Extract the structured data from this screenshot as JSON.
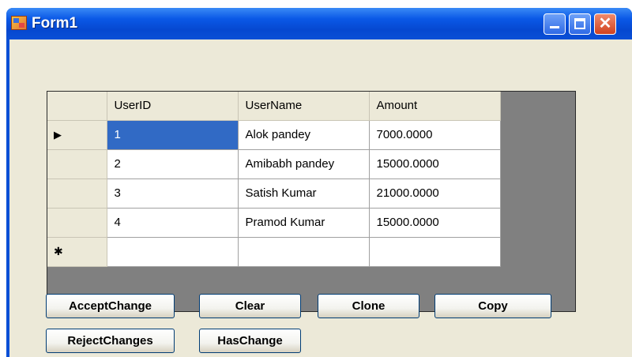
{
  "window": {
    "title": "Form1",
    "close_glyph": "✕"
  },
  "grid": {
    "columns": [
      "",
      "UserID",
      "UserName",
      "Amount"
    ],
    "current_row_indicator": "▶",
    "new_row_indicator": "✱",
    "rows": [
      {
        "user_id": "1",
        "user_name": "Alok pandey",
        "amount": "7000.0000"
      },
      {
        "user_id": "2",
        "user_name": "Amibabh pandey",
        "amount": "15000.0000"
      },
      {
        "user_id": "3",
        "user_name": "Satish Kumar",
        "amount": "21000.0000"
      },
      {
        "user_id": "4",
        "user_name": "Pramod Kumar",
        "amount": "15000.0000"
      }
    ]
  },
  "buttons": {
    "accept": "AcceptChange",
    "clear": "Clear",
    "clone": "Clone",
    "copy": "Copy",
    "reject": "RejectChanges",
    "has_change": "HasChange"
  },
  "colors": {
    "title_bar": "#0a4fd6",
    "selection": "#316ac5",
    "form_bg": "#ece9d8",
    "grid_bg": "#808080"
  }
}
